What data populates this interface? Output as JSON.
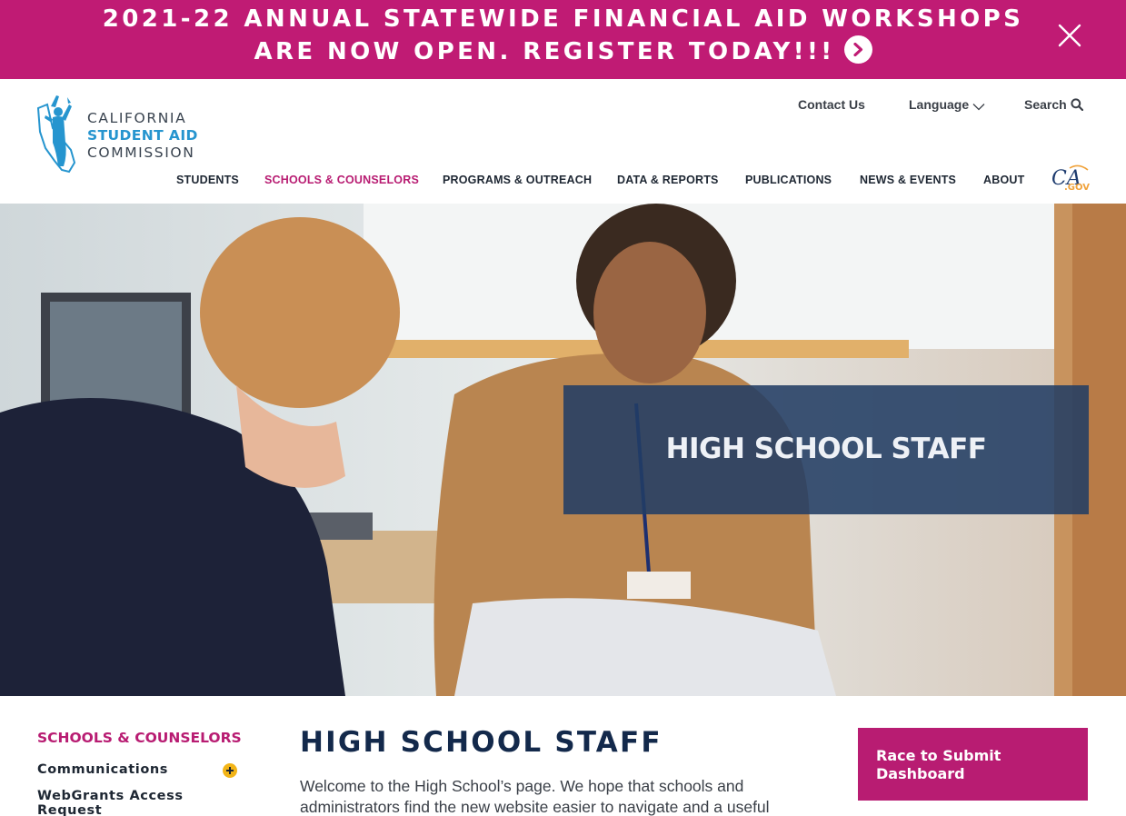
{
  "banner": {
    "line1": "2021-22 ANNUAL STATEWIDE FINANCIAL AID WORKSHOPS",
    "line2": "ARE NOW OPEN. REGISTER TODAY!!!",
    "bg_color": "#c01b74",
    "arrow_icon": "chevron-right-circle-icon",
    "close_icon": "close-icon"
  },
  "logo": {
    "line1": "CALIFORNIA",
    "line2": "STUDENT AID",
    "line3": "COMMISSION"
  },
  "utility_nav": {
    "contact": "Contact Us",
    "language": "Language",
    "search": "Search"
  },
  "main_nav": [
    {
      "label": "STUDENTS",
      "active": false
    },
    {
      "label": "SCHOOLS & COUNSELORS",
      "active": true
    },
    {
      "label": "PROGRAMS & OUTREACH",
      "active": false
    },
    {
      "label": "DATA & REPORTS",
      "active": false
    },
    {
      "label": "PUBLICATIONS",
      "active": false
    },
    {
      "label": "NEWS & EVENTS",
      "active": false
    },
    {
      "label": "ABOUT",
      "active": false
    }
  ],
  "cagov": {
    "ca": "CA",
    "gov": ".GOV"
  },
  "hero": {
    "title": "HIGH SCHOOL STAFF",
    "image": "photo of a student talking with a smiling staff member in an office"
  },
  "sidebar": {
    "title": "SCHOOLS & COUNSELORS",
    "items": [
      {
        "label": "Communications",
        "expandable": true
      },
      {
        "label": "WebGrants Access Request",
        "expandable": false
      }
    ]
  },
  "main": {
    "title": "HIGH SCHOOL STAFF",
    "intro": "Welcome to the High School’s page. We hope that schools and administrators find the new website easier to navigate and a useful"
  },
  "cta": {
    "label": "Race to Submit Dashboard"
  },
  "colors": {
    "brand_magenta": "#b81c72",
    "navy": "#13294b",
    "logo_blue": "#2695cf",
    "accent_yellow": "#f2b417"
  }
}
